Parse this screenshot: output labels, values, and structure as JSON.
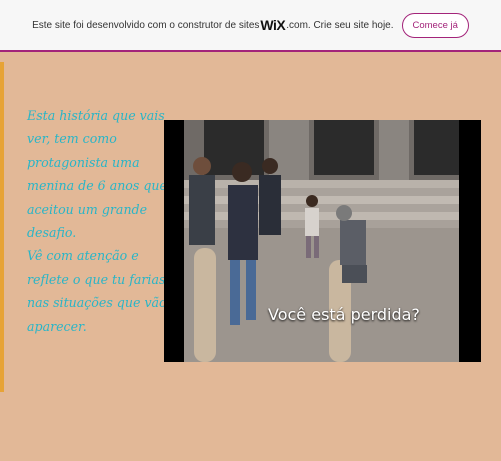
{
  "banner": {
    "text_before": "Este site foi desenvolvido com o construtor de sites",
    "logo": "WiX",
    "text_after": ".com. Crie seu site hoje.",
    "button_label": "Comece já"
  },
  "story": {
    "paragraph1": "Esta história que vais ver, tem como protagonista uma menina de 6 anos que aceitou um grande desafio.",
    "paragraph2": "Vê com atenção e reflete o que tu farias nas situações que vão aparecer."
  },
  "video": {
    "caption": "Você está perdida?"
  },
  "colors": {
    "background": "#e2b897",
    "accent": "#a3247a",
    "story_text": "#2ab5c7",
    "stripe": "#e7a336"
  }
}
